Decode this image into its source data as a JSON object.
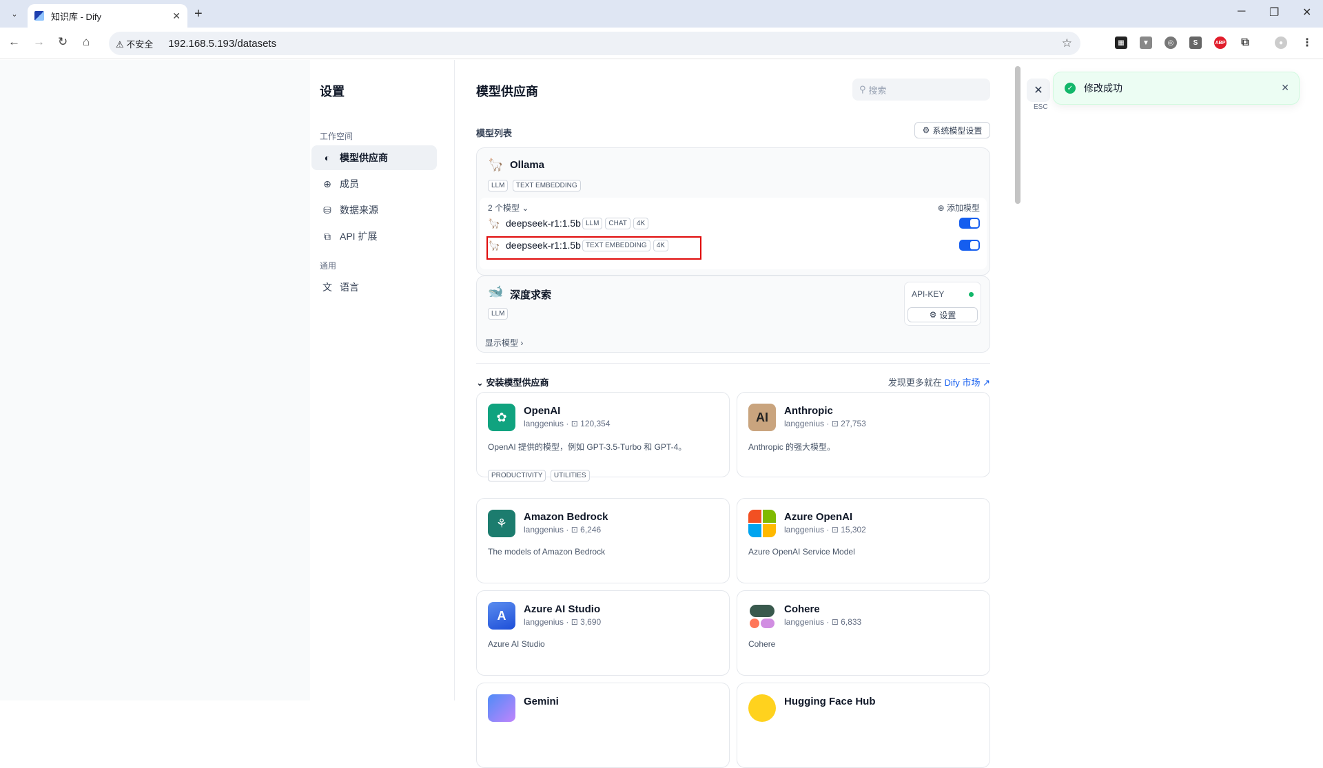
{
  "browser": {
    "tab_title": "知识库 - Dify",
    "url": "192.168.5.193/datasets",
    "insecure_label": "不安全"
  },
  "settings": {
    "title": "设置",
    "group_workspace": "工作空间",
    "group_general": "通用",
    "items": [
      {
        "label": "模型供应商"
      },
      {
        "label": "成员"
      },
      {
        "label": "数据来源"
      },
      {
        "label": "API 扩展"
      },
      {
        "label": "语言"
      }
    ]
  },
  "main": {
    "title": "模型供应商",
    "search_placeholder": "搜索",
    "model_list_label": "模型列表",
    "system_model_settings": "系统模型设置",
    "providers": [
      {
        "name": "Ollama",
        "tags": [
          "LLM",
          "TEXT EMBEDDING"
        ],
        "model_count": "2 个模型",
        "add_model": "添加模型",
        "models": [
          {
            "name": "deepseek-r1:1.5b",
            "tags": [
              "LLM",
              "CHAT",
              "4K"
            ],
            "enabled": true
          },
          {
            "name": "deepseek-r1:1.5b",
            "tags": [
              "TEXT EMBEDDING",
              "4K"
            ],
            "enabled": true
          }
        ]
      },
      {
        "name": "深度求索",
        "tags": [
          "LLM"
        ],
        "api_key": "API-KEY",
        "setting": "设置",
        "show_models": "显示模型"
      }
    ],
    "install_label": "安装模型供应商",
    "discover_prefix": "发现更多就在",
    "discover_link": "Dify 市场",
    "plugins": [
      {
        "name": "OpenAI",
        "author": "langgenius",
        "installs": "120,354",
        "desc": "OpenAI 提供的模型，例如 GPT-3.5-Turbo 和 GPT-4。",
        "tags": [
          "PRODUCTIVITY",
          "UTILITIES"
        ]
      },
      {
        "name": "Anthropic",
        "author": "langgenius",
        "installs": "27,753",
        "desc": "Anthropic 的强大模型。",
        "tags": []
      },
      {
        "name": "Amazon Bedrock",
        "author": "langgenius",
        "installs": "6,246",
        "desc": "The models of Amazon Bedrock",
        "tags": []
      },
      {
        "name": "Azure OpenAI",
        "author": "langgenius",
        "installs": "15,302",
        "desc": "Azure OpenAI Service Model",
        "tags": []
      },
      {
        "name": "Azure AI Studio",
        "author": "langgenius",
        "installs": "3,690",
        "desc": "Azure AI Studio",
        "tags": []
      },
      {
        "name": "Cohere",
        "author": "langgenius",
        "installs": "6,833",
        "desc": "Cohere",
        "tags": []
      },
      {
        "name": "Gemini",
        "author": "",
        "installs": "",
        "desc": "",
        "tags": []
      },
      {
        "name": "Hugging Face Hub",
        "author": "",
        "installs": "",
        "desc": "",
        "tags": []
      }
    ]
  },
  "toast": {
    "message": "修改成功",
    "esc": "ESC"
  }
}
